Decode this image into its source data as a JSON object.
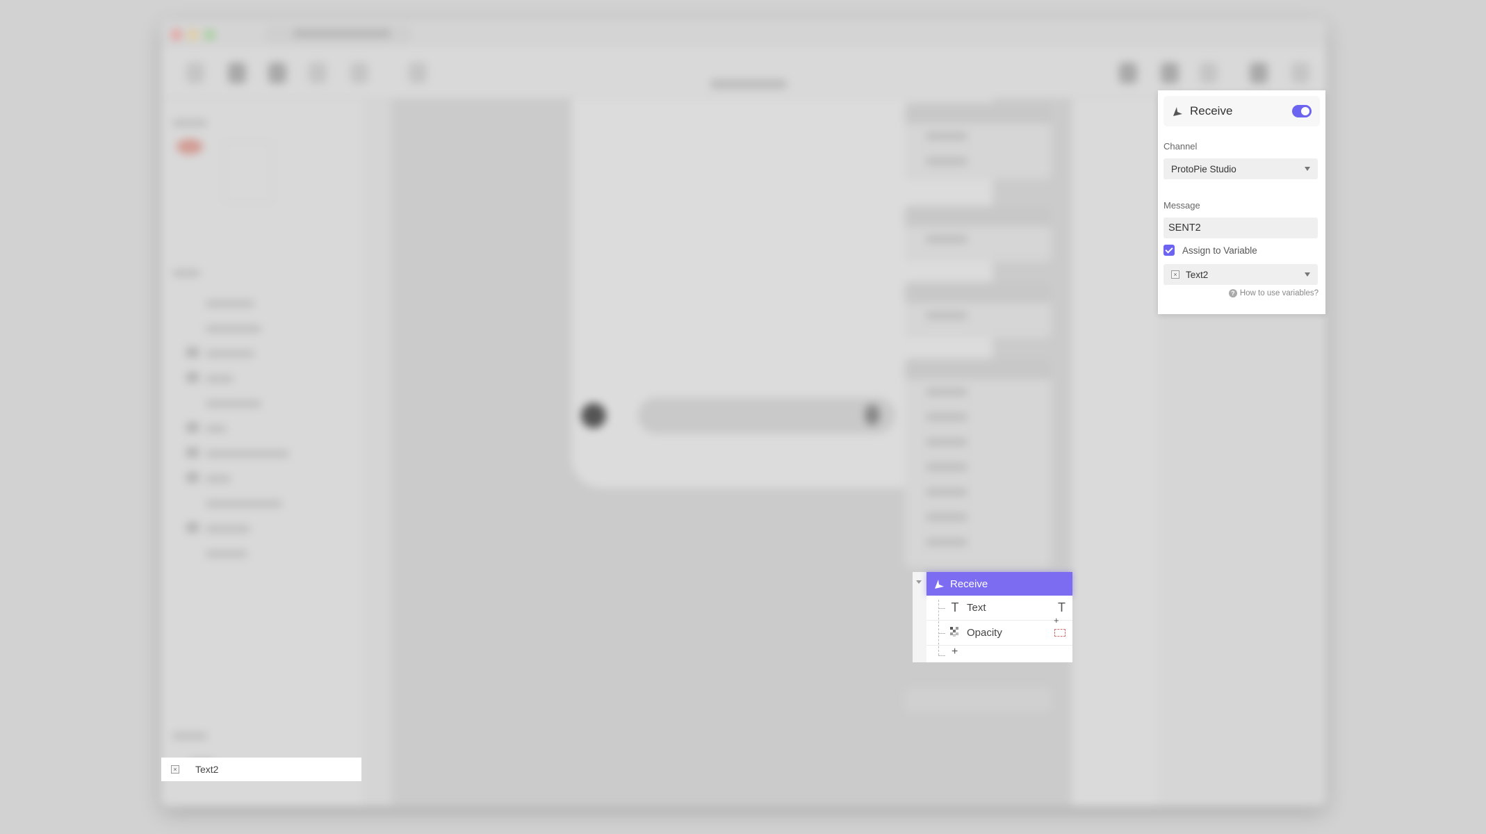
{
  "properties_panel": {
    "trigger_title": "Receive",
    "trigger_icon": "receive-icon",
    "enabled": true,
    "channel_label": "Channel",
    "channel_value": "ProtoPie Studio",
    "message_label": "Message",
    "message_value": "SENT2",
    "assign_label": "Assign to Variable",
    "assign_checked": true,
    "variable_value": "Text2",
    "variable_icon": "variable-icon",
    "help_link": "How to use variables?"
  },
  "variables_panel": {
    "selected_variable": "Text2"
  },
  "interaction_block": {
    "trigger_label": "Receive",
    "responses": [
      {
        "label": "Text",
        "icon": "text-icon"
      },
      {
        "label": "Opacity",
        "icon": "opacity-icon"
      }
    ],
    "add_label": "+"
  },
  "colors": {
    "accent": "#6c63f0",
    "trigger_header": "#7b6cf2",
    "backdrop": "#d2d2d2"
  }
}
